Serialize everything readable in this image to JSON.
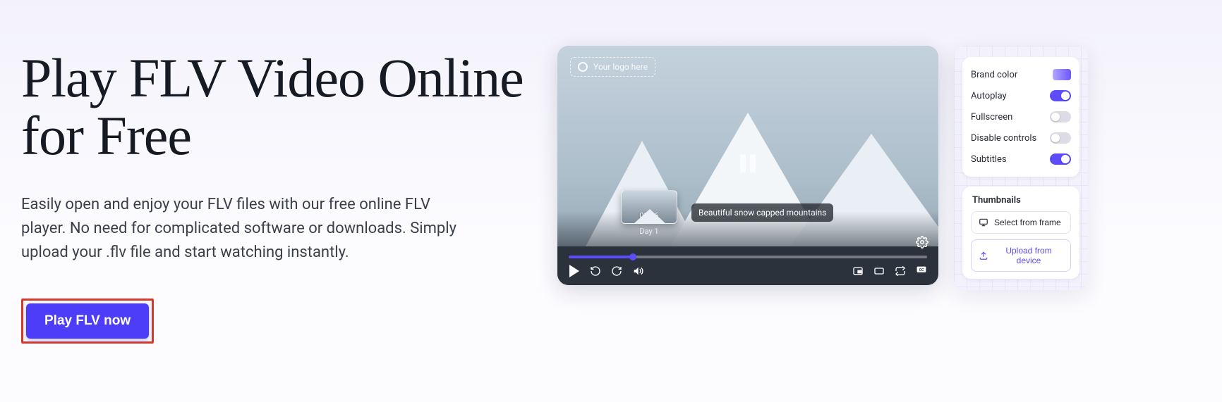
{
  "hero": {
    "title": "Play FLV Video Online for Free",
    "subtitle": "Easily open and enjoy your FLV files with our free online FLV player. No need for complicated software or downloads. Simply upload your .flv file and start watching instantly.",
    "cta_label": "Play FLV now"
  },
  "player": {
    "logo_placeholder": "Your logo here",
    "tooltip": "Beautiful snow capped mountains",
    "thumb_time": "02:46",
    "thumb_day": "Day 1"
  },
  "settings": {
    "rows": [
      {
        "label": "Brand color",
        "type": "swatch",
        "on": true
      },
      {
        "label": "Autoplay",
        "type": "toggle",
        "on": true
      },
      {
        "label": "Fullscreen",
        "type": "toggle",
        "on": false
      },
      {
        "label": "Disable controls",
        "type": "toggle",
        "on": false
      },
      {
        "label": "Subtitles",
        "type": "toggle",
        "on": true
      }
    ],
    "thumbnails_heading": "Thumbnails",
    "btn_frame": "Select from frame",
    "btn_upload": "Upload from device"
  }
}
